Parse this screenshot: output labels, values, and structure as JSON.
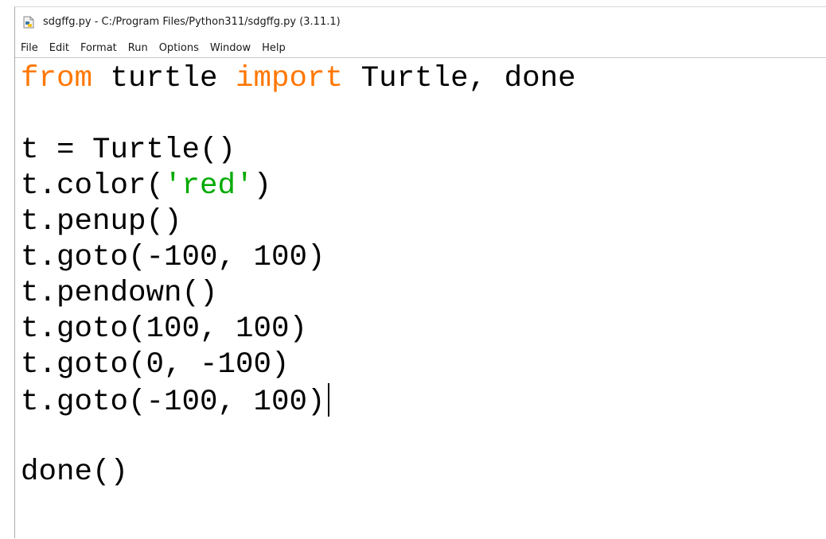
{
  "window": {
    "title": "sdgffg.py - C:/Program Files/Python311/sdgffg.py (3.11.1)",
    "icon": "python-file-icon"
  },
  "menubar": {
    "items": [
      "File",
      "Edit",
      "Format",
      "Run",
      "Options",
      "Window",
      "Help"
    ]
  },
  "editor": {
    "lines": [
      [
        {
          "text": "from",
          "kind": "keyword"
        },
        {
          "text": " turtle ",
          "kind": "plain"
        },
        {
          "text": "import",
          "kind": "keyword"
        },
        {
          "text": " Turtle, done",
          "kind": "plain"
        }
      ],
      [],
      [
        {
          "text": "t = Turtle()",
          "kind": "plain"
        }
      ],
      [
        {
          "text": "t.color(",
          "kind": "plain"
        },
        {
          "text": "'red'",
          "kind": "string"
        },
        {
          "text": ")",
          "kind": "plain"
        }
      ],
      [
        {
          "text": "t.penup()",
          "kind": "plain"
        }
      ],
      [
        {
          "text": "t.goto(-100, 100)",
          "kind": "plain"
        }
      ],
      [
        {
          "text": "t.pendown()",
          "kind": "plain"
        }
      ],
      [
        {
          "text": "t.goto(100, 100)",
          "kind": "plain"
        }
      ],
      [
        {
          "text": "t.goto(0, -100)",
          "kind": "plain"
        }
      ],
      [
        {
          "text": "t.goto(-100, 100)",
          "kind": "plain"
        }
      ],
      [],
      [
        {
          "text": "done()",
          "kind": "plain"
        }
      ]
    ],
    "cursor_line": 9,
    "colors": {
      "keyword": "#ff7700",
      "string": "#00aa00",
      "plain": "#000000"
    }
  }
}
